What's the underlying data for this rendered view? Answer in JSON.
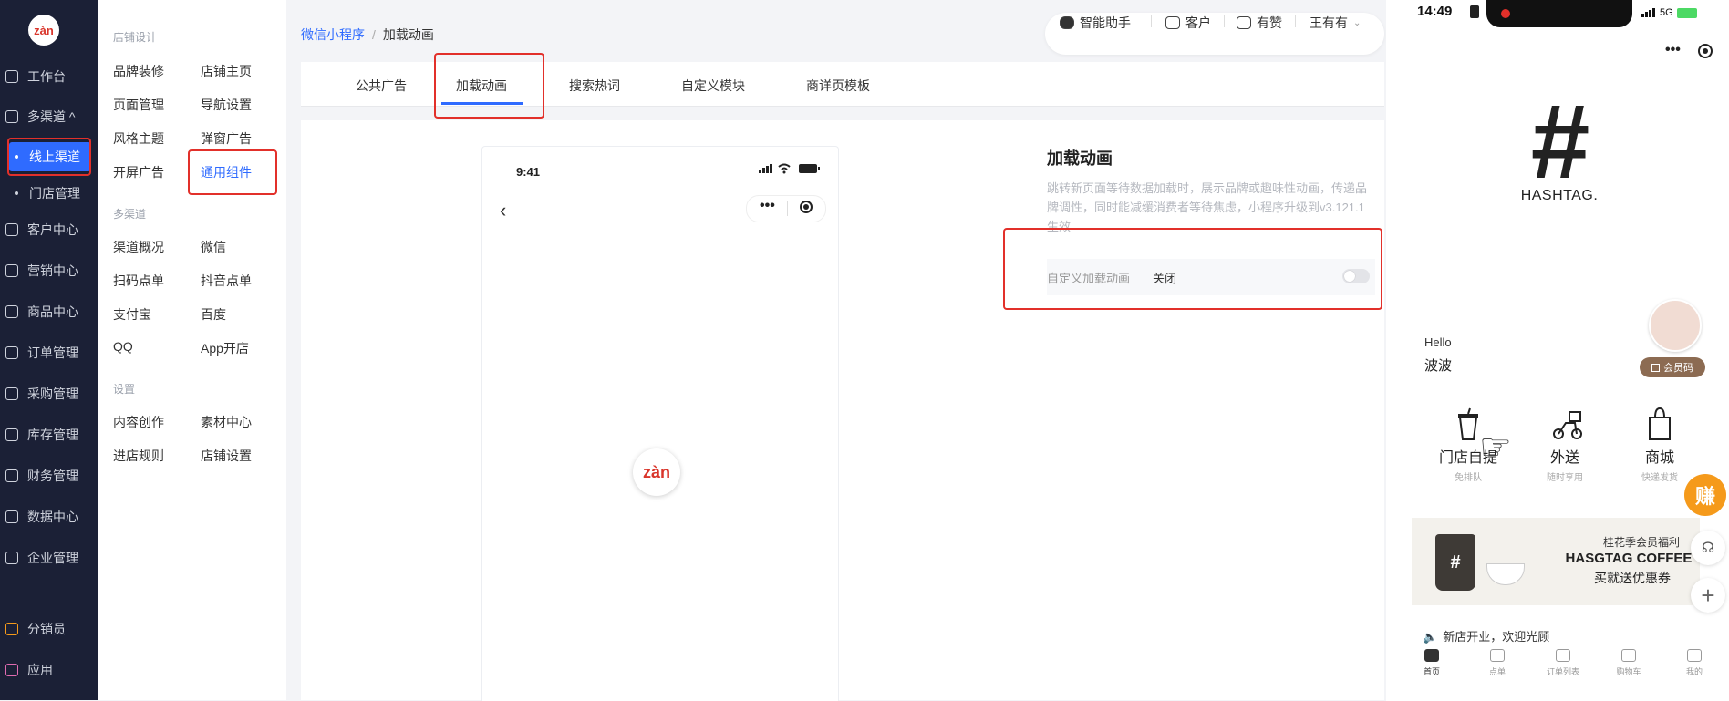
{
  "left_nav": {
    "logo_text": "zàn",
    "items": [
      {
        "label": "工作台",
        "icon": "monitor-icon"
      },
      {
        "label": "多渠道 ^",
        "icon": "store-icon"
      },
      {
        "label": "客户中心",
        "icon": "user-icon"
      },
      {
        "label": "营销中心",
        "icon": "gift-icon"
      },
      {
        "label": "商品中心",
        "icon": "bag-icon"
      },
      {
        "label": "订单管理",
        "icon": "order-icon"
      },
      {
        "label": "采购管理",
        "icon": "purchase-icon"
      },
      {
        "label": "库存管理",
        "icon": "warehouse-icon"
      },
      {
        "label": "财务管理",
        "icon": "finance-icon"
      },
      {
        "label": "数据中心",
        "icon": "chart-icon"
      },
      {
        "label": "企业管理",
        "icon": "company-icon"
      },
      {
        "label": "分销员",
        "icon": "distributor-icon"
      },
      {
        "label": "应用",
        "icon": "apps-icon"
      }
    ],
    "sub_items": [
      {
        "label": "线上渠道"
      },
      {
        "label": "门店管理"
      }
    ]
  },
  "sub_menu": {
    "sections": [
      {
        "title": "店铺设计",
        "items": [
          "品牌装修",
          "店铺主页",
          "页面管理",
          "导航设置",
          "风格主题",
          "弹窗广告",
          "开屏广告",
          "通用组件"
        ]
      },
      {
        "title": "多渠道",
        "items": [
          "渠道概况",
          "微信",
          "扫码点单",
          "抖音点单",
          "支付宝",
          "百度",
          "QQ",
          "App开店"
        ]
      },
      {
        "title": "设置",
        "items": [
          "内容创作",
          "素材中心",
          "进店规则",
          "店铺设置"
        ]
      }
    ]
  },
  "breadcrumb": {
    "root": "微信小程序",
    "sep": "/",
    "current": "加载动画"
  },
  "top_right": {
    "assistant": "智能助手",
    "customer": "客户",
    "like": "有赞",
    "user": "王有有"
  },
  "tabs": [
    "公共广告",
    "加载动画",
    "搜索热词",
    "自定义模块",
    "商详页模板"
  ],
  "preview_phone": {
    "time": "9:41",
    "logo_text": "zàn"
  },
  "settings_panel": {
    "title": "加载动画",
    "description": "跳转新页面等待数据加载时，展示品牌或趣味性动画，传递品牌调性，同时能减缓消费者等待焦虑，小程序升级到v3.121.1生效",
    "row_label": "自定义加载动画",
    "row_value": "关闭",
    "toggle_on": false
  },
  "right_phone": {
    "time": "14:49",
    "signal": "5G",
    "brand_symbol": "#",
    "brand_name": "HASHTAG.",
    "greeting": "Hello",
    "user_name": "波波",
    "vip_button": "会员码",
    "services": [
      {
        "label": "门店自提",
        "sub": "免排队"
      },
      {
        "label": "外送",
        "sub": "随时享用"
      },
      {
        "label": "商城",
        "sub": "快递发货"
      }
    ],
    "earn_badge": "赚",
    "banner": {
      "line1": "桂花季会员福利",
      "line2": "HASGTAG COFFEE",
      "line3": "买就送优惠券"
    },
    "notice": "新店开业，欢迎光顾",
    "bottom_tabs": [
      "首页",
      "点单",
      "订单列表",
      "购物车",
      "我的"
    ]
  },
  "colors": {
    "accent": "#2f6bff",
    "highlight_box": "#e2302a",
    "nav_bg": "#1b2036",
    "earn": "#f59a1b"
  }
}
